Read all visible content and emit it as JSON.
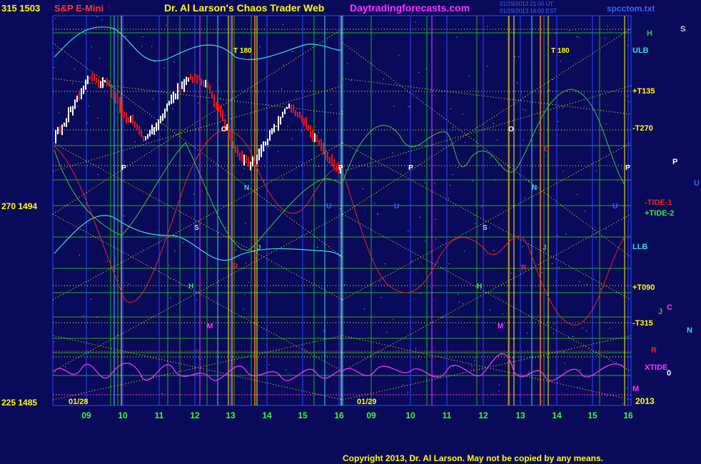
{
  "header": {
    "left_label": "315  1503",
    "symbol": "S&P E-Mini",
    "site_title": "Dr. Al Larson's Chaos Trader Web",
    "site_url": "Daytradingforecasts.com",
    "timestamp_line1": "01/29/2013 21:00 UT",
    "timestamp_line2": "01/29/2013 16:00 EST",
    "file_name": "spcctom.txt"
  },
  "footer": {
    "copyright": "Copyright 2013, Dr. Al Larson. May not be copied by any means."
  },
  "colors": {
    "background": "#0a0a5a",
    "grid_blue": "#2a4bff",
    "grid_green": "#22aa22",
    "cyan": "#33dddd",
    "yellow": "#ffff00",
    "red": "#ee2222",
    "magenta": "#ff33ff",
    "green_line": "#33cc33",
    "orange": "#ff8800",
    "white": "#ffffff"
  },
  "chart_data": {
    "type": "line",
    "price_axis": [
      {
        "angle": "315",
        "price": "1503",
        "value": 1503
      },
      {
        "angle": "270",
        "price": "1494",
        "value": 1494
      },
      {
        "angle": "225",
        "price": "1485",
        "value": 1485
      }
    ],
    "x_ticks_day1": [
      "09",
      "10",
      "11",
      "12",
      "13",
      "14",
      "15",
      "16"
    ],
    "x_ticks_day2": [
      "09",
      "10",
      "11",
      "12",
      "13",
      "14",
      "15",
      "16"
    ],
    "date_labels": [
      "01/28",
      "01/29"
    ],
    "year_label": "2013",
    "right_labels": [
      {
        "text": "H",
        "color": "#33cc33"
      },
      {
        "text": "S",
        "color": "#cccccc"
      },
      {
        "text": "ULB",
        "color": "#33dddd"
      },
      {
        "text": "+T135",
        "color": "#ffff00"
      },
      {
        "text": "-T270",
        "color": "#ffff00"
      },
      {
        "text": "P",
        "color": "#ffffff"
      },
      {
        "text": "U",
        "color": "#3366ff"
      },
      {
        "text": "-TIDE-1",
        "color": "#ee2222"
      },
      {
        "text": "+TIDE-2",
        "color": "#33ee33"
      },
      {
        "text": "LLB",
        "color": "#33dddd"
      },
      {
        "text": "+T090",
        "color": "#ffff00"
      },
      {
        "text": "J",
        "color": "#33cc33"
      },
      {
        "text": "C",
        "color": "#ff33ff"
      },
      {
        "text": "-T315",
        "color": "#ffff00"
      },
      {
        "text": "N",
        "color": "#33dddd"
      },
      {
        "text": "R",
        "color": "#ee2222"
      },
      {
        "text": "XTIDE",
        "color": "#ff33ff"
      },
      {
        "text": "0",
        "color": "#ffffff"
      },
      {
        "text": "M",
        "color": "#ff33ff"
      }
    ],
    "in_chart_labels": [
      {
        "text": "T 180"
      },
      {
        "text": "T 180"
      },
      {
        "text": "O"
      },
      {
        "text": "O"
      },
      {
        "text": "P"
      },
      {
        "text": "P"
      },
      {
        "text": "P"
      },
      {
        "text": "P"
      },
      {
        "text": "S"
      },
      {
        "text": "S"
      },
      {
        "text": "H"
      },
      {
        "text": "H"
      },
      {
        "text": "M"
      },
      {
        "text": "M"
      },
      {
        "text": "J"
      },
      {
        "text": "J"
      },
      {
        "text": "N"
      },
      {
        "text": "N"
      },
      {
        "text": "R"
      },
      {
        "text": "R"
      },
      {
        "text": "C"
      },
      {
        "text": "U"
      },
      {
        "text": "U"
      },
      {
        "text": "U"
      }
    ]
  }
}
